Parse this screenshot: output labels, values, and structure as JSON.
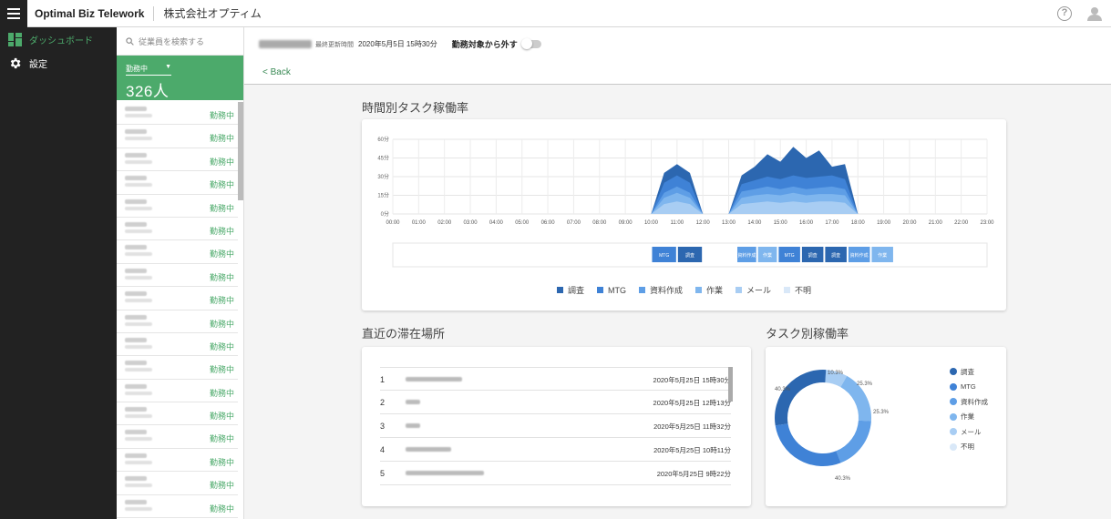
{
  "topbar": {
    "app_title": "Optimal Biz Telework",
    "company": "株式会社オプティム",
    "help_glyph": "?"
  },
  "nav": {
    "items": [
      {
        "label": "ダッシュボード",
        "icon": "dashboard-icon",
        "active": true
      },
      {
        "label": "設定",
        "icon": "gear-icon",
        "active": false
      }
    ]
  },
  "employees": {
    "search_placeholder": "従業員を検索する",
    "status_filter": "勤務中",
    "count": "326人",
    "rows": [
      "勤務中",
      "勤務中",
      "勤務中",
      "勤務中",
      "勤務中",
      "勤務中",
      "勤務中",
      "勤務中",
      "勤務中",
      "勤務中",
      "勤務中",
      "勤務中",
      "勤務中",
      "勤務中",
      "勤務中",
      "勤務中",
      "勤務中",
      "勤務中"
    ]
  },
  "header": {
    "last_login_label": "最終更新時間",
    "last_login_value": "2020年5月5日 15時30分",
    "exclude_label": "勤務対象から外す"
  },
  "back_label": "Back",
  "hourly": {
    "title": "時間別タスク稼働率",
    "chart_data": {
      "type": "area",
      "y_ticks": [
        "60分",
        "45分",
        "30分",
        "15分",
        "0分"
      ],
      "ylim": [
        0,
        60
      ],
      "x_ticks": [
        "00:00",
        "01:00",
        "02:00",
        "03:00",
        "04:00",
        "05:00",
        "06:00",
        "07:00",
        "08:00",
        "09:00",
        "10:00",
        "11:00",
        "12:00",
        "13:00",
        "14:00",
        "15:00",
        "16:00",
        "17:00",
        "18:00",
        "19:00",
        "20:00",
        "21:00",
        "22:00",
        "23:00"
      ],
      "x": [
        10,
        10.5,
        11,
        11.5,
        12,
        13,
        13.5,
        14,
        14.5,
        15,
        15.5,
        16,
        16.5,
        17,
        17.5,
        18
      ],
      "series": [
        {
          "name": "不明",
          "values": [
            0,
            0,
            0,
            0,
            0,
            0,
            0,
            0,
            0,
            0,
            0,
            0,
            0,
            0,
            0,
            0
          ]
        },
        {
          "name": "メール",
          "values": [
            0,
            8,
            10,
            8,
            0,
            0,
            8,
            9,
            10,
            9,
            10,
            9,
            10,
            10,
            9,
            0
          ]
        },
        {
          "name": "作業",
          "values": [
            0,
            13,
            17,
            13,
            0,
            0,
            13,
            15,
            16,
            15,
            17,
            15,
            16,
            16,
            15,
            0
          ]
        },
        {
          "name": "資料作成",
          "values": [
            0,
            17,
            22,
            17,
            0,
            0,
            18,
            20,
            22,
            20,
            22,
            20,
            21,
            22,
            20,
            0
          ]
        },
        {
          "name": "MTG",
          "values": [
            0,
            25,
            31,
            25,
            0,
            0,
            24,
            27,
            30,
            28,
            31,
            29,
            30,
            31,
            28,
            0
          ]
        },
        {
          "name": "調査",
          "values": [
            0,
            33,
            40,
            33,
            0,
            0,
            31,
            38,
            48,
            42,
            54,
            45,
            51,
            38,
            40,
            0
          ]
        }
      ]
    },
    "timeline": [
      {
        "label": "MTG",
        "start": 10,
        "end": 11
      },
      {
        "label": "調査",
        "start": 11,
        "end": 12
      },
      {
        "label": "資料作成",
        "start": 13.3,
        "end": 14.1
      },
      {
        "label": "作業",
        "start": 14.1,
        "end": 14.9
      },
      {
        "label": "MTG",
        "start": 14.9,
        "end": 15.8
      },
      {
        "label": "調査",
        "start": 15.8,
        "end": 16.7
      },
      {
        "label": "調査",
        "start": 16.7,
        "end": 17.6
      },
      {
        "label": "資料作成",
        "start": 17.6,
        "end": 18.5
      },
      {
        "label": "作業",
        "start": 18.5,
        "end": 19.4
      }
    ],
    "legend": [
      {
        "label": "調査",
        "color": "#2c67b0"
      },
      {
        "label": "MTG",
        "color": "#3f82d6"
      },
      {
        "label": "資料作成",
        "color": "#5e9ee6"
      },
      {
        "label": "作業",
        "color": "#7fb6ee"
      },
      {
        "label": "メール",
        "color": "#a8cdf3"
      },
      {
        "label": "不明",
        "color": "#d9e8f8"
      }
    ]
  },
  "locations": {
    "title": "直近の滞在場所",
    "rows": [
      {
        "idx": "1",
        "time": "2020年5月25日 15時30分",
        "blur_w": 62
      },
      {
        "idx": "2",
        "time": "2020年5月25日 12時13分",
        "blur_w": 16
      },
      {
        "idx": "3",
        "time": "2020年5月25日 11時32分",
        "blur_w": 16
      },
      {
        "idx": "4",
        "time": "2020年5月25日 10時11分",
        "blur_w": 50
      },
      {
        "idx": "5",
        "time": "2020年5月25日 9時22分",
        "blur_w": 86
      }
    ]
  },
  "task_rate": {
    "title": "タスク別稼働率",
    "chart_data": {
      "type": "pie",
      "labels": [
        "調査",
        "MTG",
        "資料作成",
        "作業",
        "メール",
        "不明"
      ],
      "values": [
        40.3,
        40.3,
        25.3,
        25.3,
        10.3,
        0
      ],
      "value_labels": [
        "40.3%",
        "40.3%",
        "25.3%",
        "25.3%",
        "10.3%"
      ],
      "colors": [
        "#2c67b0",
        "#3f82d6",
        "#5e9ee6",
        "#7fb6ee",
        "#a8cdf3",
        "#d9e8f8"
      ]
    }
  }
}
